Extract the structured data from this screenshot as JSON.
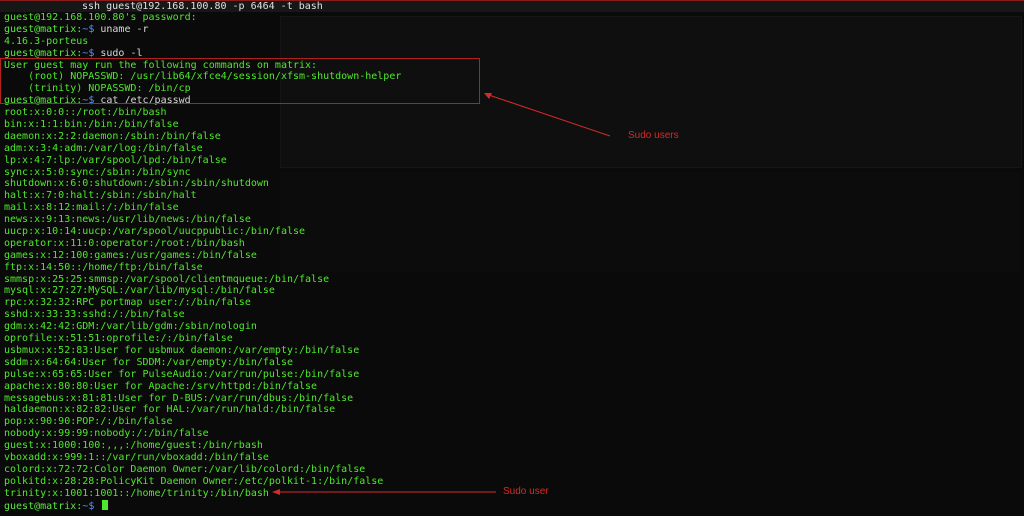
{
  "window": {
    "title": "ssh guest@192.168.100.80 -p 6464 -t bash"
  },
  "terminal": {
    "lines": [
      {
        "type": "out",
        "text": "guest@192.168.100.80's password:"
      },
      {
        "type": "prompt",
        "user": "guest",
        "host": "matrix",
        "path": "~",
        "cmd": "uname -r"
      },
      {
        "type": "out",
        "text": "4.16.3-porteus"
      },
      {
        "type": "prompt",
        "user": "guest",
        "host": "matrix",
        "path": "~",
        "cmd": "sudo -l"
      },
      {
        "type": "out",
        "text": "User guest may run the following commands on matrix:"
      },
      {
        "type": "out",
        "text": "    (root) NOPASSWD: /usr/lib64/xfce4/session/xfsm-shutdown-helper"
      },
      {
        "type": "out",
        "text": "    (trinity) NOPASSWD: /bin/cp"
      },
      {
        "type": "prompt",
        "user": "guest",
        "host": "matrix",
        "path": "~",
        "cmd": "cat /etc/passwd"
      },
      {
        "type": "out",
        "text": "root:x:0:0::/root:/bin/bash"
      },
      {
        "type": "out",
        "text": "bin:x:1:1:bin:/bin:/bin/false"
      },
      {
        "type": "out",
        "text": "daemon:x:2:2:daemon:/sbin:/bin/false"
      },
      {
        "type": "out",
        "text": "adm:x:3:4:adm:/var/log:/bin/false"
      },
      {
        "type": "out",
        "text": "lp:x:4:7:lp:/var/spool/lpd:/bin/false"
      },
      {
        "type": "out",
        "text": "sync:x:5:0:sync:/sbin:/bin/sync"
      },
      {
        "type": "out",
        "text": "shutdown:x:6:0:shutdown:/sbin:/sbin/shutdown"
      },
      {
        "type": "out",
        "text": "halt:x:7:0:halt:/sbin:/sbin/halt"
      },
      {
        "type": "out",
        "text": "mail:x:8:12:mail:/:/bin/false"
      },
      {
        "type": "out",
        "text": "news:x:9:13:news:/usr/lib/news:/bin/false"
      },
      {
        "type": "out",
        "text": "uucp:x:10:14:uucp:/var/spool/uucppublic:/bin/false"
      },
      {
        "type": "out",
        "text": "operator:x:11:0:operator:/root:/bin/bash"
      },
      {
        "type": "out",
        "text": "games:x:12:100:games:/usr/games:/bin/false"
      },
      {
        "type": "out",
        "text": "ftp:x:14:50::/home/ftp:/bin/false"
      },
      {
        "type": "out",
        "text": "smmsp:x:25:25:smmsp:/var/spool/clientmqueue:/bin/false"
      },
      {
        "type": "out",
        "text": "mysql:x:27:27:MySQL:/var/lib/mysql:/bin/false"
      },
      {
        "type": "out",
        "text": "rpc:x:32:32:RPC portmap user:/:/bin/false"
      },
      {
        "type": "out",
        "text": "sshd:x:33:33:sshd:/:/bin/false"
      },
      {
        "type": "out",
        "text": "gdm:x:42:42:GDM:/var/lib/gdm:/sbin/nologin"
      },
      {
        "type": "out",
        "text": "oprofile:x:51:51:oprofile:/:/bin/false"
      },
      {
        "type": "out",
        "text": "usbmux:x:52:83:User for usbmux daemon:/var/empty:/bin/false"
      },
      {
        "type": "out",
        "text": "sddm:x:64:64:User for SDDM:/var/empty:/bin/false"
      },
      {
        "type": "out",
        "text": "pulse:x:65:65:User for PulseAudio:/var/run/pulse:/bin/false"
      },
      {
        "type": "out",
        "text": "apache:x:80:80:User for Apache:/srv/httpd:/bin/false"
      },
      {
        "type": "out",
        "text": "messagebus:x:81:81:User for D-BUS:/var/run/dbus:/bin/false"
      },
      {
        "type": "out",
        "text": "haldaemon:x:82:82:User for HAL:/var/run/hald:/bin/false"
      },
      {
        "type": "out",
        "text": "pop:x:90:90:POP:/:/bin/false"
      },
      {
        "type": "out",
        "text": "nobody:x:99:99:nobody:/:/bin/false"
      },
      {
        "type": "out",
        "text": "guest:x:1000:100:,,,:/home/guest:/bin/rbash"
      },
      {
        "type": "out",
        "text": "vboxadd:x:999:1::/var/run/vboxadd:/bin/false"
      },
      {
        "type": "out",
        "text": "colord:x:72:72:Color Daemon Owner:/var/lib/colord:/bin/false"
      },
      {
        "type": "out",
        "text": "polkitd:x:28:28:PolicyKit Daemon Owner:/etc/polkit-1:/bin/false"
      },
      {
        "type": "out",
        "text": "trinity:x:1001:1001::/home/trinity:/bin/bash"
      },
      {
        "type": "prompt_cursor",
        "user": "guest",
        "host": "matrix",
        "path": "~",
        "cmd": ""
      }
    ]
  },
  "annotations": {
    "sudo_users": "Sudo users",
    "sudo_user": "Sudo user",
    "color": "#d62a2a"
  }
}
